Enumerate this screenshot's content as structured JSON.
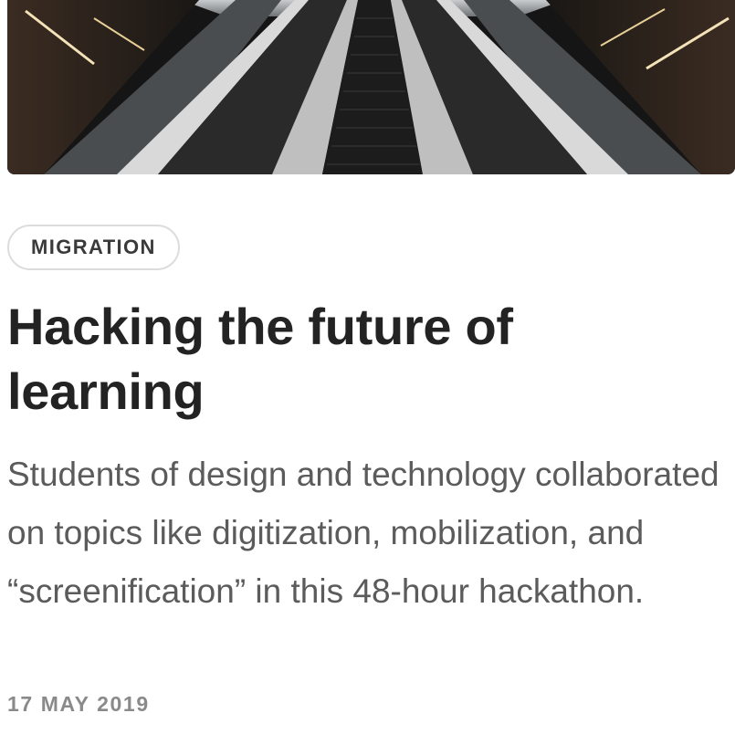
{
  "article": {
    "image_alt": "Escalator photograph",
    "tag": "MIGRATION",
    "title": "Hacking the future of learning",
    "summary": "Students of design and technology collaborated on topics like digitization, mobilization, and “screenification” in this 48-hour hackathon.",
    "date": "17 MAY 2019"
  },
  "colors": {
    "title": "#232323",
    "summary": "#5b5b5b",
    "date": "#8a8a8a",
    "tag_border": "#dcdcdc"
  }
}
